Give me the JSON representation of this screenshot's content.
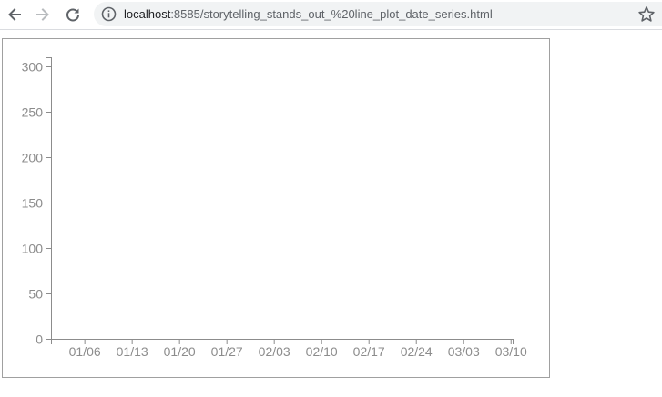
{
  "browser": {
    "url_host": "localhost",
    "url_path": ":8585/storytelling_stands_out_%20line_plot_date_series.html",
    "icons": {
      "back": "arrow-left-icon",
      "forward": "arrow-right-icon",
      "reload": "reload-icon",
      "site_info": "info-icon",
      "bookmark": "star-icon"
    }
  },
  "chart_data": {
    "type": "line",
    "title": "",
    "xlabel": "",
    "ylabel": "",
    "x_tick_labels": [
      "01/06",
      "01/13",
      "01/20",
      "01/27",
      "02/03",
      "02/10",
      "02/17",
      "02/24",
      "03/03",
      "03/10"
    ],
    "x_range": [
      "01/01",
      "03/10"
    ],
    "y_ticks": [
      0,
      50,
      100,
      150,
      200,
      250,
      300
    ],
    "ylim": [
      0,
      310
    ],
    "series": [],
    "grid": false,
    "colors": {
      "axis": "#8c8c8c",
      "tick_text": "#8c8c8c",
      "frame": "#a0a0a0"
    }
  }
}
